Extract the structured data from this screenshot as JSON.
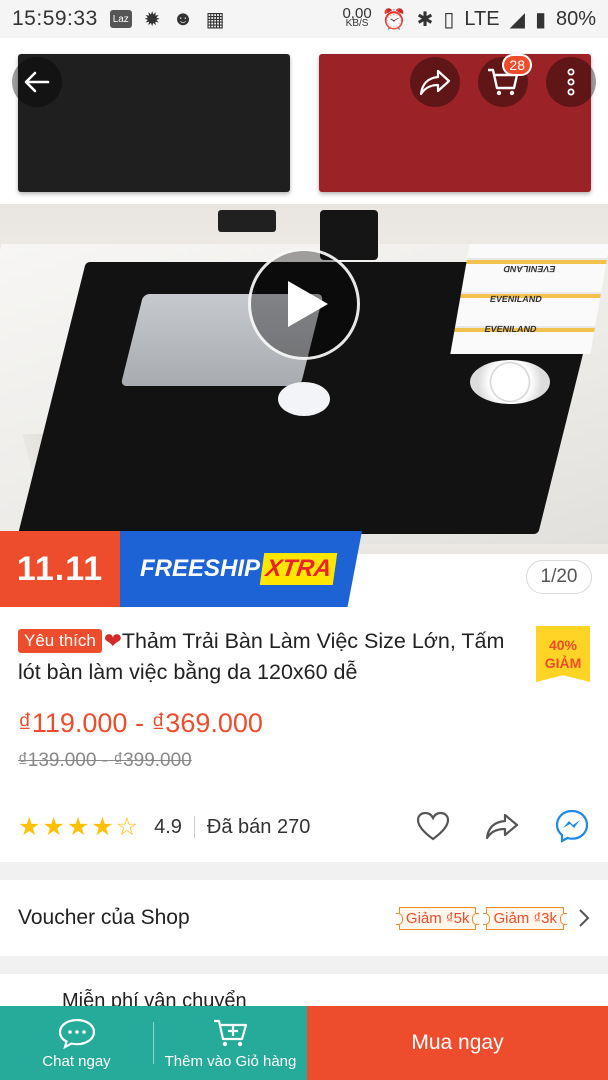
{
  "status_bar": {
    "time": "15:59:33",
    "app_badge": "Laz",
    "net_speed": "0,00",
    "net_unit": "KB/S",
    "network": "LTE",
    "battery": "80%"
  },
  "gallery": {
    "counter": "1/20",
    "cart_count": "28",
    "book_label": "EVENILAND"
  },
  "promo": {
    "sale_label": "11.11",
    "freeship_label": "FREESHIP",
    "xtra_label": "XTRA"
  },
  "product": {
    "tag": "Yêu thích",
    "heart": "❤",
    "title": "Thảm Trải Bàn Làm Việc Size Lớn, Tấm lót bàn làm việc bằng da 120x60 dễ",
    "discount_percent": "40%",
    "discount_label": "GIẢM",
    "price": "₫119.000 - ₫369.000",
    "old_price": "₫139.000 - ₫399.000",
    "rating": "4.9",
    "stars_value": 4.9,
    "sold": "Đã bán 270"
  },
  "voucher": {
    "label": "Voucher của Shop",
    "tags": [
      "Giảm ₫5k",
      "Giảm ₫3k"
    ]
  },
  "next_section": {
    "label": "Miễn phí vận chuyển"
  },
  "bottom_bar": {
    "chat_label": "Chat ngay",
    "cart_label": "Thêm vào Giỏ hàng",
    "buy_label": "Mua ngay"
  },
  "colors": {
    "accent": "#ee4d2d",
    "teal": "#26aa99",
    "freeship_blue": "#1e63d6",
    "star": "#ffc107"
  },
  "icons": {
    "back": "arrow-left-icon",
    "share": "share-icon",
    "cart": "cart-icon",
    "more": "more-vertical-icon",
    "play": "play-icon",
    "like": "heart-outline-icon",
    "messenger": "messenger-icon",
    "chevron": "chevron-right-icon"
  }
}
